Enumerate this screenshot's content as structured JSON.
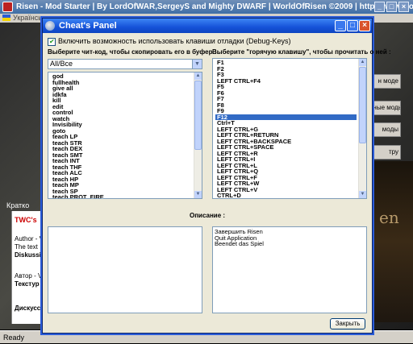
{
  "main_window": {
    "title": "Risen - Mod Starter  |  By LordOfWAR,SergeyS and Mighty DWARF  |  WorldOfRisen ©2009  |  http://www.worldofrisen.de/",
    "language": "Українськ",
    "right_buttons": [
      "н моде",
      "нные моды",
      "моды",
      "тру"
    ],
    "kratk": "Кратко",
    "left_texts": [
      "TWC's",
      "Author - V",
      "The text",
      "Diskussi",
      "Автор - V",
      "Текстур",
      "Дискусс"
    ],
    "right_logo": "en",
    "status": "Ready"
  },
  "dialog": {
    "title": "Cheat's Panel",
    "enable_hotkeys_label": "Включить возможность использовать клавиши отладки (Debug-Keys)",
    "enable_hotkeys_checked": true,
    "left_label": "Выберите чит-код, чтобы скопировать его в буфер :",
    "right_label": "Выберите \"горячую клавишу\", чтобы прочитать о ней :",
    "category_combo": "All/Все",
    "cheat_codes": [
      "god",
      "fullhealth",
      "give all",
      "idkfa",
      "kill",
      "edit",
      "control",
      "watch",
      "Invisibility",
      "goto",
      "teach LP",
      "teach STR",
      "teach DEX",
      "teach SMT",
      "teach INT",
      "teach THF",
      "teach ALC",
      "teach HP",
      "teach MP",
      "teach SP",
      "teach PROT_FIRE"
    ],
    "hotkeys": [
      "F1",
      "F2",
      "F3",
      "LEFT CTRL+F4",
      "F5",
      "F6",
      "F7",
      "F8",
      "F9",
      "F12",
      "Ctrl+T",
      "LEFT CTRL+G",
      "LEFT CTRL+RETURN",
      "LEFT CTRL+BACKSPACE",
      "LEFT CTRL+SPACE",
      "LEFT CTRL+R",
      "LEFT CTRL+I",
      "LEFT CTRL+L",
      "LEFT CTRL+Q",
      "LEFT CTRL+F",
      "LEFT CTRL+W",
      "LEFT CTRL+V",
      "CTRL+D"
    ],
    "selected_hotkey": "F12",
    "description_label": "Описание :",
    "description_lines": [
      "Завершить Risen",
      "Quit Application",
      "Beendet das Spiel"
    ],
    "close_button": "Закрыть"
  }
}
